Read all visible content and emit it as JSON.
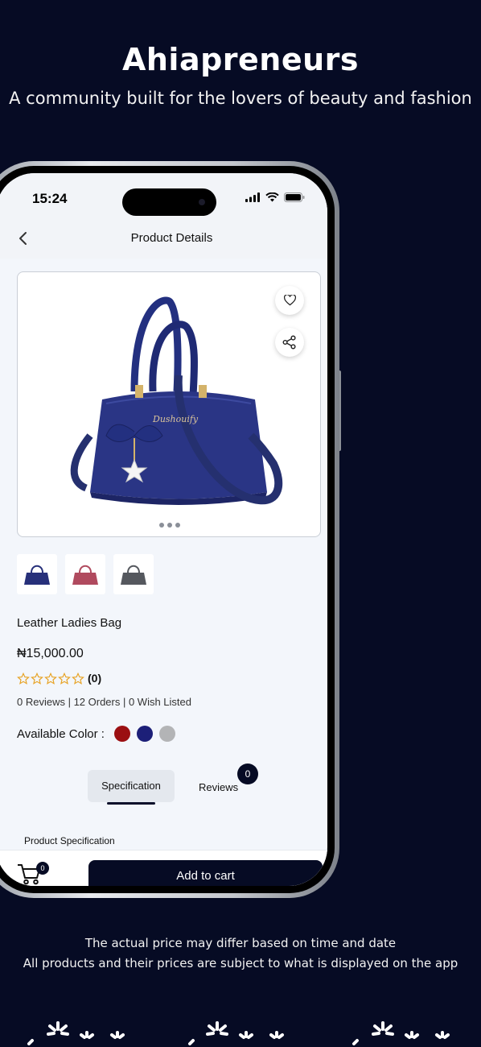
{
  "hero": {
    "title": "Ahiapreneurs",
    "subtitle": "A community built for the lovers of beauty and fashion"
  },
  "status_bar": {
    "time": "15:24"
  },
  "app_bar": {
    "title": "Product Details"
  },
  "product": {
    "name": "Leather Ladies Bag",
    "price": "₦15,000.00",
    "rating_count": "(0)",
    "stars_filled": 0,
    "stars_total": 5,
    "stats": "0 Reviews | 12 Orders | 0 Wish Listed",
    "colors_label": "Available Color :",
    "colors": [
      "#9b0f12",
      "#1c1f78",
      "#b3b4b6"
    ],
    "thumbnail_colors": [
      "#27307a",
      "#b04a5e",
      "#55585e"
    ],
    "main_image_color": "#2a3585"
  },
  "tabs": {
    "specification": "Specification",
    "reviews": "Reviews",
    "reviews_badge": "0"
  },
  "section": {
    "spec_heading": "Product Specification"
  },
  "cart": {
    "badge": "0",
    "add_label": "Add to cart"
  },
  "disclaimer": {
    "line1": "The actual price may differ based on time and date",
    "line2": "All products and their prices are subject to what is displayed on the app"
  }
}
